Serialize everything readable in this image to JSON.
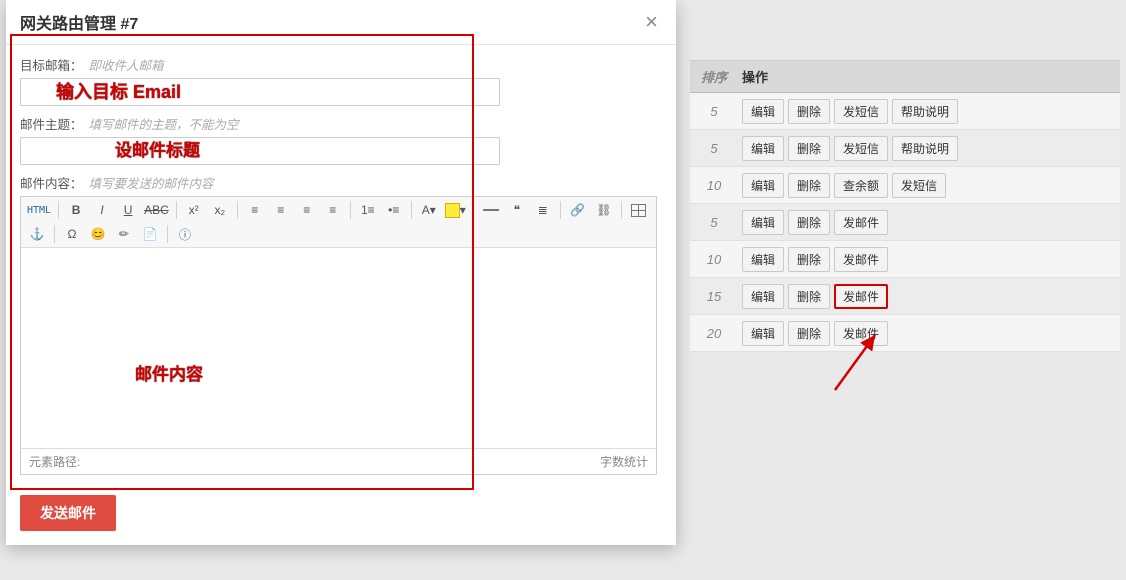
{
  "modal": {
    "title": "网关路由管理 #7",
    "close": "×",
    "fields": {
      "to_label": "目标邮箱：",
      "to_hint": "即收件人邮箱",
      "to_value": "",
      "subj_label": "邮件主题：",
      "subj_hint": "填写邮件的主题，不能为空",
      "subj_value": "",
      "body_label": "邮件内容：",
      "body_hint": "填写要发送的邮件内容"
    },
    "editor": {
      "html_btn": "HTML",
      "path_label": "元素路径:",
      "count_label": "字数统计"
    },
    "send_btn": "发送邮件"
  },
  "table": {
    "head_order": "排序",
    "head_ops": "操作",
    "rows": [
      {
        "order": "5",
        "ops": [
          "编辑",
          "删除",
          "发短信",
          "帮助说明"
        ]
      },
      {
        "order": "5",
        "ops": [
          "编辑",
          "删除",
          "发短信",
          "帮助说明"
        ]
      },
      {
        "order": "10",
        "ops": [
          "编辑",
          "删除",
          "查余额",
          "发短信"
        ]
      },
      {
        "order": "5",
        "ops": [
          "编辑",
          "删除",
          "发邮件"
        ]
      },
      {
        "order": "10",
        "ops": [
          "编辑",
          "删除",
          "发邮件"
        ]
      },
      {
        "order": "15",
        "ops": [
          "编辑",
          "删除",
          "发邮件"
        ],
        "highlight": 2
      },
      {
        "order": "20",
        "ops": [
          "编辑",
          "删除",
          "发邮件"
        ]
      }
    ]
  },
  "annotations": {
    "email_target": "输入目标 Email",
    "subject": "设邮件标题",
    "content": "邮件内容"
  }
}
